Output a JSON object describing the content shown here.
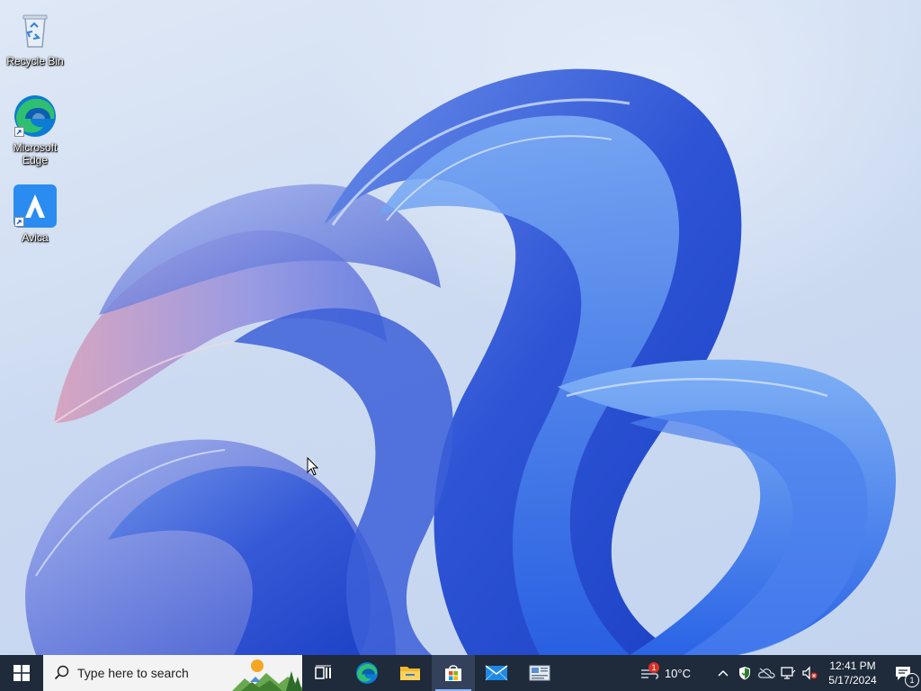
{
  "desktop": {
    "icons": [
      {
        "label": "Recycle Bin",
        "icon": "recycle-bin-icon"
      },
      {
        "label": "Microsoft\nEdge",
        "icon": "edge-icon"
      },
      {
        "label": "Avica",
        "icon": "avica-icon"
      }
    ]
  },
  "taskbar": {
    "search_placeholder": "Type here to search",
    "apps": [
      {
        "name": "task-view",
        "icon": "task-view-icon"
      },
      {
        "name": "edge",
        "icon": "edge-icon"
      },
      {
        "name": "file-explorer",
        "icon": "folder-icon"
      },
      {
        "name": "microsoft-store",
        "icon": "store-icon"
      },
      {
        "name": "mail",
        "icon": "mail-icon"
      },
      {
        "name": "news",
        "icon": "news-icon"
      }
    ],
    "weather": {
      "temperature": "10°C",
      "alert_count": "1"
    },
    "clock": {
      "time": "12:41 PM",
      "date": "5/17/2024"
    },
    "notification_count": "1"
  },
  "colors": {
    "taskbar_bg": "#1f2a3a",
    "search_bg": "#f3f3f3",
    "accent": "#0078d4"
  }
}
